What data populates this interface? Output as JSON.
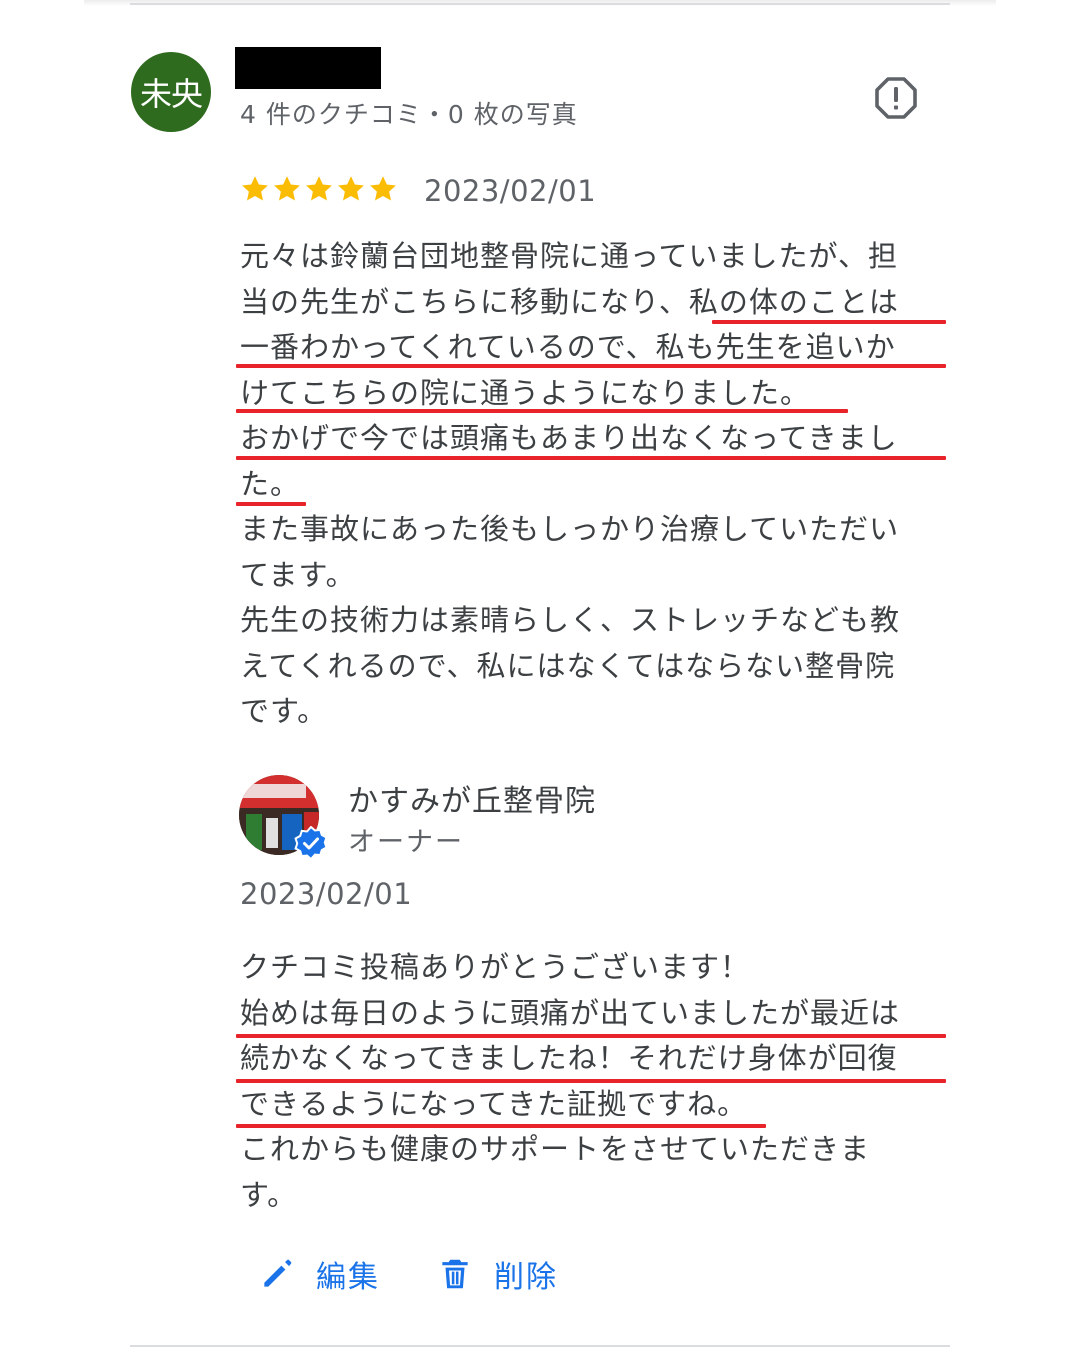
{
  "reviewer": {
    "avatar_text": "未央",
    "avatar_color": "#2e6b1e",
    "meta": "4 件のクチコミ・0 枚の写真",
    "report_icon": "report-icon"
  },
  "review": {
    "rating": 5,
    "date": "2023/02/01",
    "lines": [
      "元々は鈴蘭台団地整骨院に通っていましたが、担",
      "当の先生がこちらに移動になり、私の体のことは",
      "一番わかってくれているので、私も先生を追いか",
      "けてこちらの院に通うようになりました。",
      "おかげで今では頭痛もあまり出なくなってきまし",
      "た。",
      "また事故にあった後もしっかり治療していただい",
      "てます。",
      "先生の技術力は素晴らしく、ストレッチなども教",
      "えてくれるので、私にはなくてはならない整骨院",
      "です。"
    ]
  },
  "owner_reply": {
    "name": "かすみが丘整骨院",
    "role": "オーナー",
    "date": "2023/02/01",
    "lines": [
      "クチコミ投稿ありがとうございます！",
      "始めは毎日のように頭痛が出ていましたが最近は",
      "続かなくなってきましたね！それだけ身体が回復",
      "できるようになってきた証拠ですね。",
      "これからも健康のサポートをさせていただきま",
      "す。"
    ]
  },
  "actions": {
    "edit_label": "編集",
    "delete_label": "削除"
  },
  "colors": {
    "accent": "#1a73e8",
    "star": "#fbbc04",
    "highlight_underline": "#e8232a"
  }
}
